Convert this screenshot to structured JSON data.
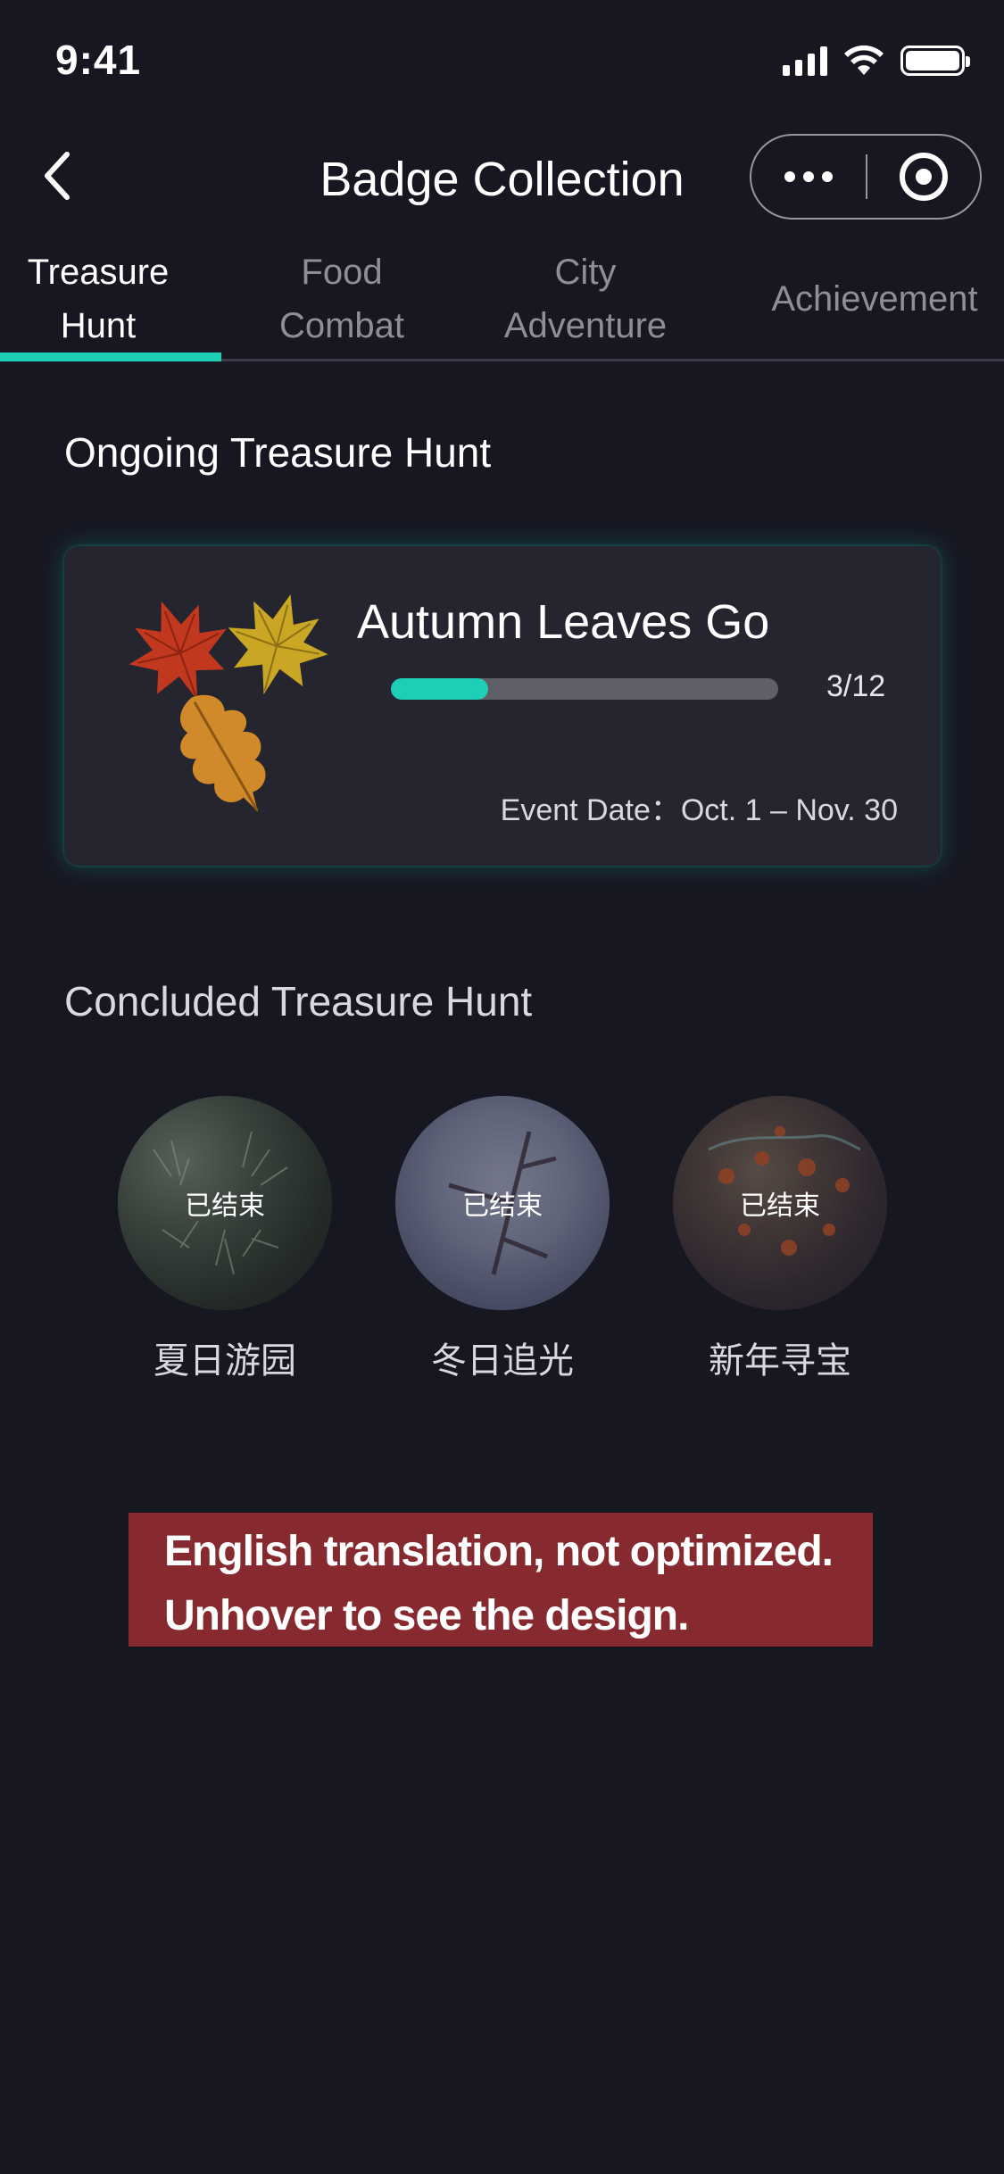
{
  "status_bar": {
    "time": "9:41"
  },
  "nav": {
    "title": "Badge Collection"
  },
  "tabs": [
    {
      "line1": "Treasure",
      "line2": "Hunt",
      "active": true
    },
    {
      "line1": "Food",
      "line2": "Combat",
      "active": false
    },
    {
      "line1": "City",
      "line2": "Adventure",
      "active": false
    },
    {
      "line1": "Achievement",
      "line2": "",
      "active": false
    }
  ],
  "ongoing": {
    "heading": "Ongoing Treasure Hunt",
    "card": {
      "title": "Autumn Leaves Go",
      "progress_current": 3,
      "progress_total": 12,
      "progress_label": "3/12",
      "event_date": "Event Date：Oct. 1 – Nov. 30"
    }
  },
  "concluded": {
    "heading": "Concluded Treasure Hunt",
    "items": [
      {
        "status": "已结束",
        "name": "夏日游园"
      },
      {
        "status": "已结束",
        "name": "冬日追光"
      },
      {
        "status": "已结束",
        "name": "新年寻宝"
      }
    ]
  },
  "notice": {
    "line1": "English translation, not optimized.",
    "line2": "Unhover to see the design."
  },
  "colors": {
    "background": "#171722",
    "accent": "#1ecfb7",
    "card": "#25252f",
    "notice": "#862a30"
  }
}
